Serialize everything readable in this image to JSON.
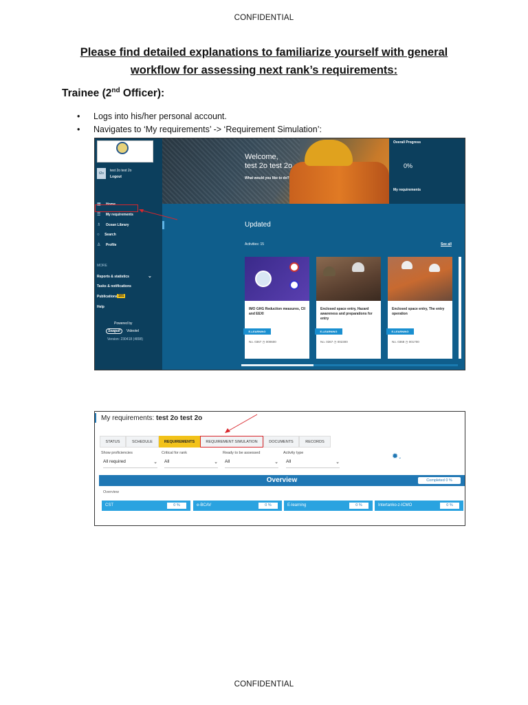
{
  "header": "CONFIDENTIAL",
  "footer": "CONFIDENTIAL",
  "heading": {
    "line1": "Please find detailed explanations to familiarize yourself with general",
    "line2": "workflow for assessing next rank’s requirements:"
  },
  "section": {
    "title_pre": "Trainee (2",
    "title_sup": "nd",
    "title_post": " Officer):"
  },
  "bullets": [
    "Logs into his/her personal account.",
    "Navigates to ‘My requirements’ -> ‘Requirement Simulation’:"
  ],
  "screenshot1": {
    "user": {
      "initials": "t2o",
      "name": "test 2o test 2o",
      "logout": "Logout"
    },
    "nav": [
      {
        "icon": "home-icon",
        "glyph": "▦",
        "label": "Home"
      },
      {
        "icon": "list-icon",
        "glyph": "☰",
        "label": "My requirements"
      },
      {
        "icon": "book-icon",
        "glyph": "♗",
        "label": "Ocean Library"
      },
      {
        "icon": "search-icon",
        "glyph": "○",
        "label": "Search"
      },
      {
        "icon": "person-icon",
        "glyph": "♙",
        "label": "Profile"
      }
    ],
    "more": {
      "label": "MORE",
      "items": [
        "Reports & statistics",
        "Tasks & notifications",
        "Publications",
        "Help"
      ],
      "publications_badge": "101"
    },
    "powered_by": "Powered by",
    "brand_left": "Seagull",
    "brand_right": "Videotel",
    "version": "Version: 230418 (4898)",
    "welcome": {
      "line1": "Welcome,",
      "line2": "test 2o test 2o",
      "sub": "What would you like to do?"
    },
    "progress": {
      "title": "Overall Progress",
      "value": "0%",
      "link": "My requirements"
    },
    "updated": {
      "title": "Updated",
      "activities": "Activities: 15",
      "see_all": "See all"
    },
    "cards": [
      {
        "title": "IMO GHG Reduction measures, CII and EEXI",
        "badge": "E-LEARNING",
        "no": "No. 0367",
        "code": "000600"
      },
      {
        "title": "Enclosed space entry, Hazard awareness and preparations for entry",
        "badge": "E-LEARNING",
        "no": "No. 0367",
        "code": "002300"
      },
      {
        "title": "Enclosed space entry, The entry operation",
        "badge": "E-LEARNING",
        "no": "No. 0368",
        "code": "001700"
      }
    ],
    "colors": {
      "sidebar": "#0c3f5d",
      "main": "#0f5e8c",
      "highlight": "#d9262c",
      "badge": "#1a8fd0"
    }
  },
  "screenshot2": {
    "title_prefix": "My requirements:",
    "title_name": "test 2o test 2o",
    "tabs": [
      "STATUS",
      "SCHEDULE",
      "REQUIREMENTS",
      "REQUIREMENT SIMULATION",
      "DOCUMENTS",
      "RECORDS"
    ],
    "active_tab": "REQUIREMENTS",
    "filters": [
      {
        "label": "Show proficiencies",
        "value": "All required"
      },
      {
        "label": "Critical for rank",
        "value": "All"
      },
      {
        "label": "Ready to be assessed",
        "value": "All"
      },
      {
        "label": "Activity type",
        "value": "All"
      }
    ],
    "overview_title": "Overview",
    "completed": "Completed 0 %",
    "overview_label": "Overview",
    "categories": [
      {
        "name": "CST",
        "value": "0 %"
      },
      {
        "name": "e-BCAV",
        "value": "0 %"
      },
      {
        "name": "E-learning",
        "value": "0 %"
      },
      {
        "name": "Intertanko-z-ICMO",
        "value": "0 %"
      }
    ],
    "colors": {
      "accent": "#1f77b4",
      "active_tab": "#f2c21a",
      "pill": "#2aa3e0"
    }
  }
}
